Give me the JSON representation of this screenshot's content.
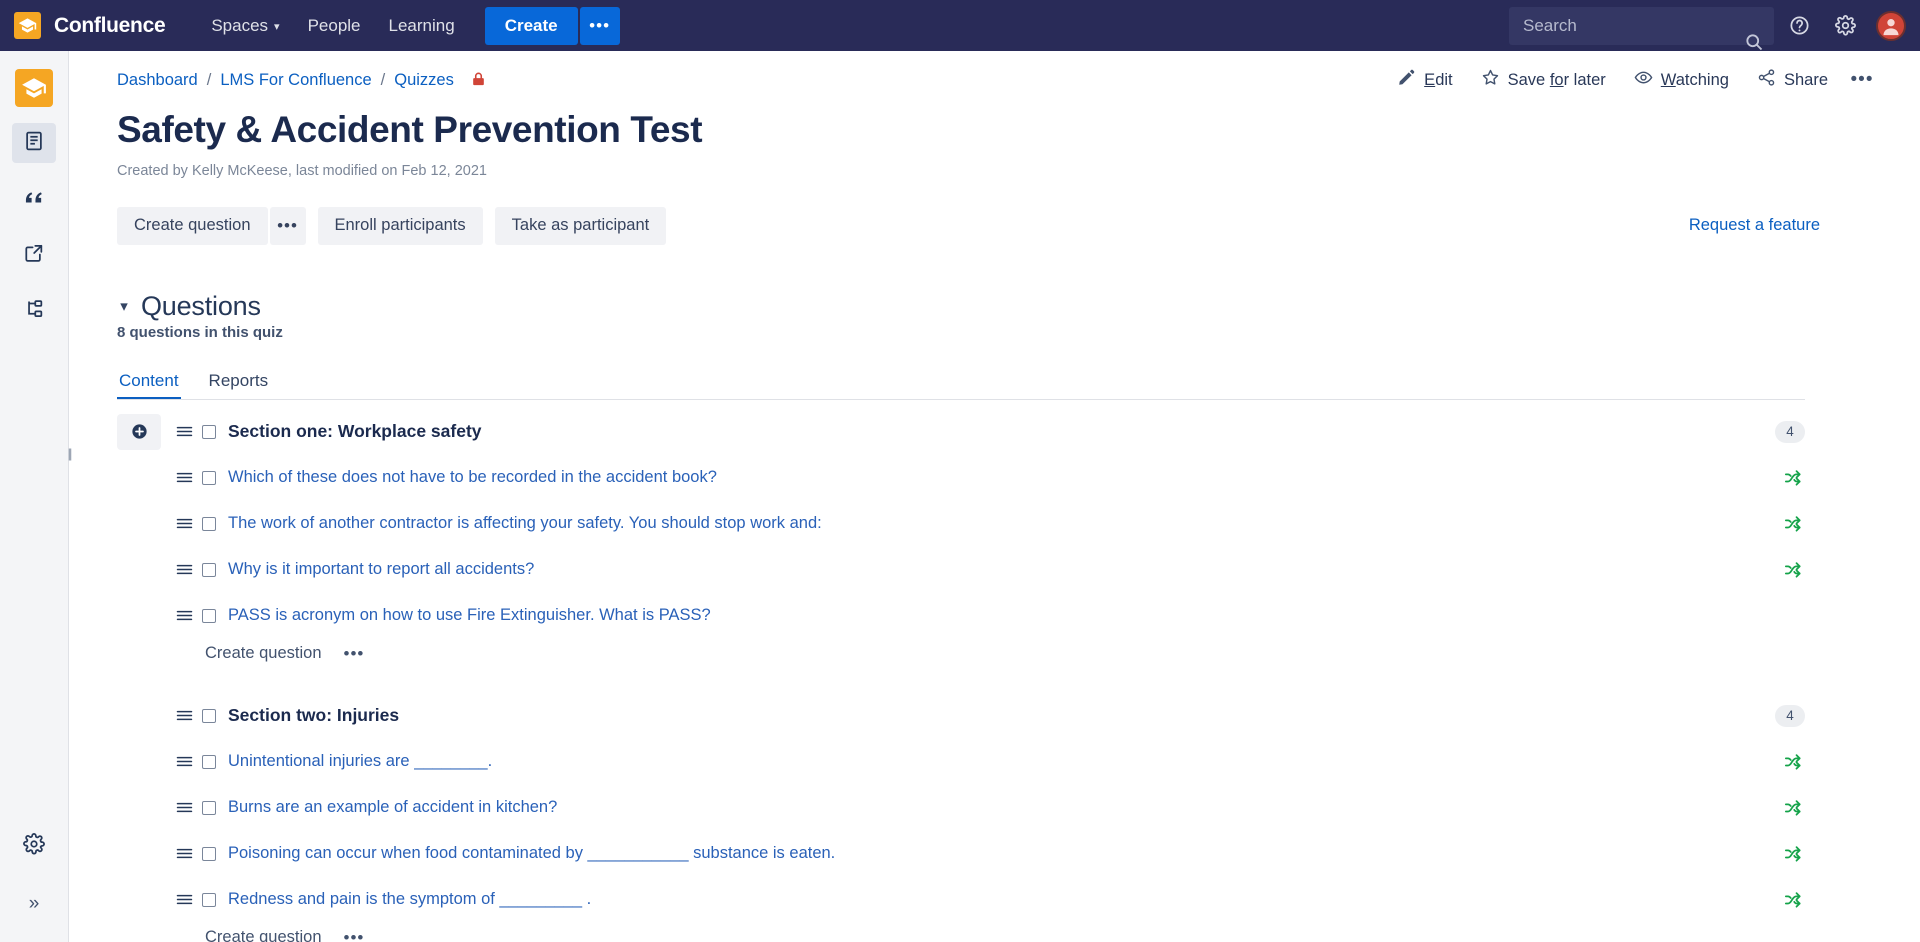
{
  "topnav": {
    "brand": "Confluence",
    "items": [
      {
        "label": "Spaces",
        "has_caret": true
      },
      {
        "label": "People",
        "has_caret": false
      },
      {
        "label": "Learning",
        "has_caret": false
      }
    ],
    "create_label": "Create",
    "create_more_label": "•••",
    "search_placeholder": "Search",
    "icons": [
      "search-icon",
      "help-icon",
      "settings-icon",
      "avatar"
    ]
  },
  "sidebar": {
    "space_logo": "graduation-cap-icon",
    "items": [
      {
        "name": "pages-icon",
        "active": true
      },
      {
        "name": "quote-icon",
        "active": false
      },
      {
        "name": "external-link-icon",
        "active": false
      },
      {
        "name": "page-tree-icon",
        "active": false
      }
    ],
    "bottom_items": [
      {
        "name": "settings-gear-icon"
      },
      {
        "name": "expand-sidebar-icon",
        "glyph": "»"
      }
    ]
  },
  "breadcrumb": {
    "items": [
      "Dashboard",
      "LMS For Confluence",
      "Quizzes"
    ],
    "separator": "/",
    "restricted_icon": "lock-icon"
  },
  "page_actions": {
    "edit": "Edit",
    "save_for_later": "Save for later",
    "watching": "Watching",
    "share": "Share",
    "more": "•••"
  },
  "page": {
    "title": "Safety & Accident Prevention Test",
    "meta": "Created by Kelly McKeese, last modified on Feb 12, 2021"
  },
  "quiz_actions": {
    "create_question": "Create question",
    "create_question_more": "•••",
    "enroll_participants": "Enroll participants",
    "take_as_participant": "Take as participant",
    "request_a_feature": "Request a feature"
  },
  "questions_section": {
    "heading": "Questions",
    "subheading": "8 questions in this quiz",
    "tabs": [
      {
        "label": "Content",
        "active": true
      },
      {
        "label": "Reports",
        "active": false
      }
    ],
    "sections": [
      {
        "title": "Section one: Workplace safety",
        "count": "4",
        "questions": [
          "Which of these does not have to be recorded in the accident book?",
          "The work of another contractor is affecting your safety. You should stop work and:",
          "Why is it important to report all accidents?",
          "PASS is acronym on how to use Fire Extinguisher. What is PASS?"
        ],
        "create_label": "Create question",
        "create_more": "•••"
      },
      {
        "title": "Section two: Injuries",
        "count": "4",
        "questions": [
          "Unintentional injuries are ________.",
          "Burns are an example of accident in kitchen?",
          "Poisoning can occur when food contaminated by ___________ substance is eaten.",
          "Redness and pain is the symptom of _________ ."
        ],
        "create_label": "Create question",
        "create_more": "•••"
      }
    ]
  },
  "colors": {
    "nav_bg": "#292b58",
    "brand_orange": "#f5a623",
    "primary_blue": "#0868d9",
    "link_blue": "#0b5fc1",
    "shuffle_green": "#15a34a",
    "title_navy": "#1b2a4e"
  }
}
